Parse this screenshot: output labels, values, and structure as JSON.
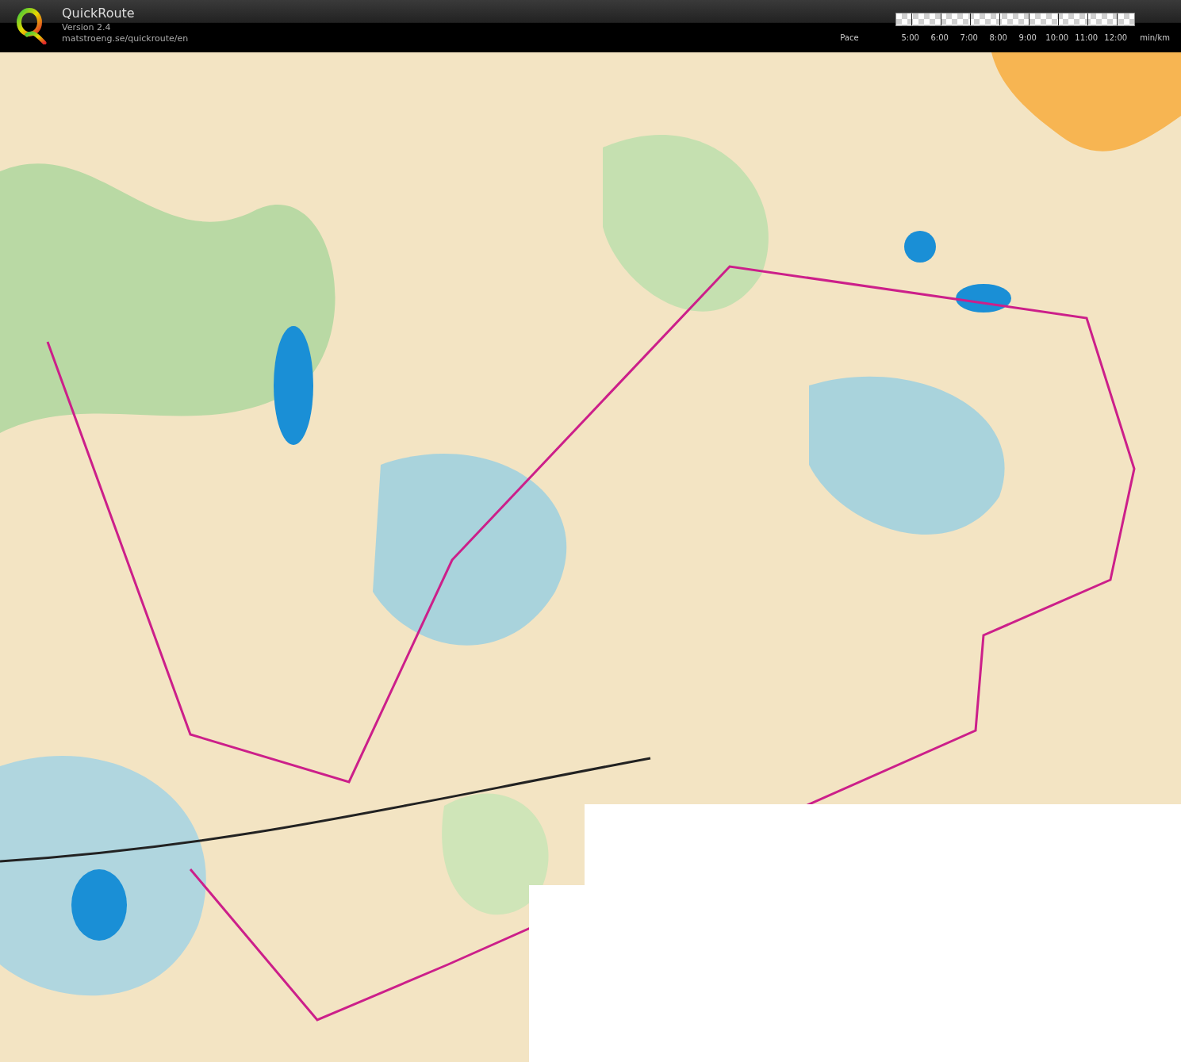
{
  "app": {
    "title": "QuickRoute",
    "version": "Version 2.4",
    "url": "matstroeng.se/quickroute/en"
  },
  "pace_legend": {
    "label": "Pace",
    "ticks": [
      "5:00",
      "6:00",
      "7:00",
      "8:00",
      "9:00",
      "10:00",
      "11:00",
      "12:00"
    ],
    "unit": "min/km"
  }
}
